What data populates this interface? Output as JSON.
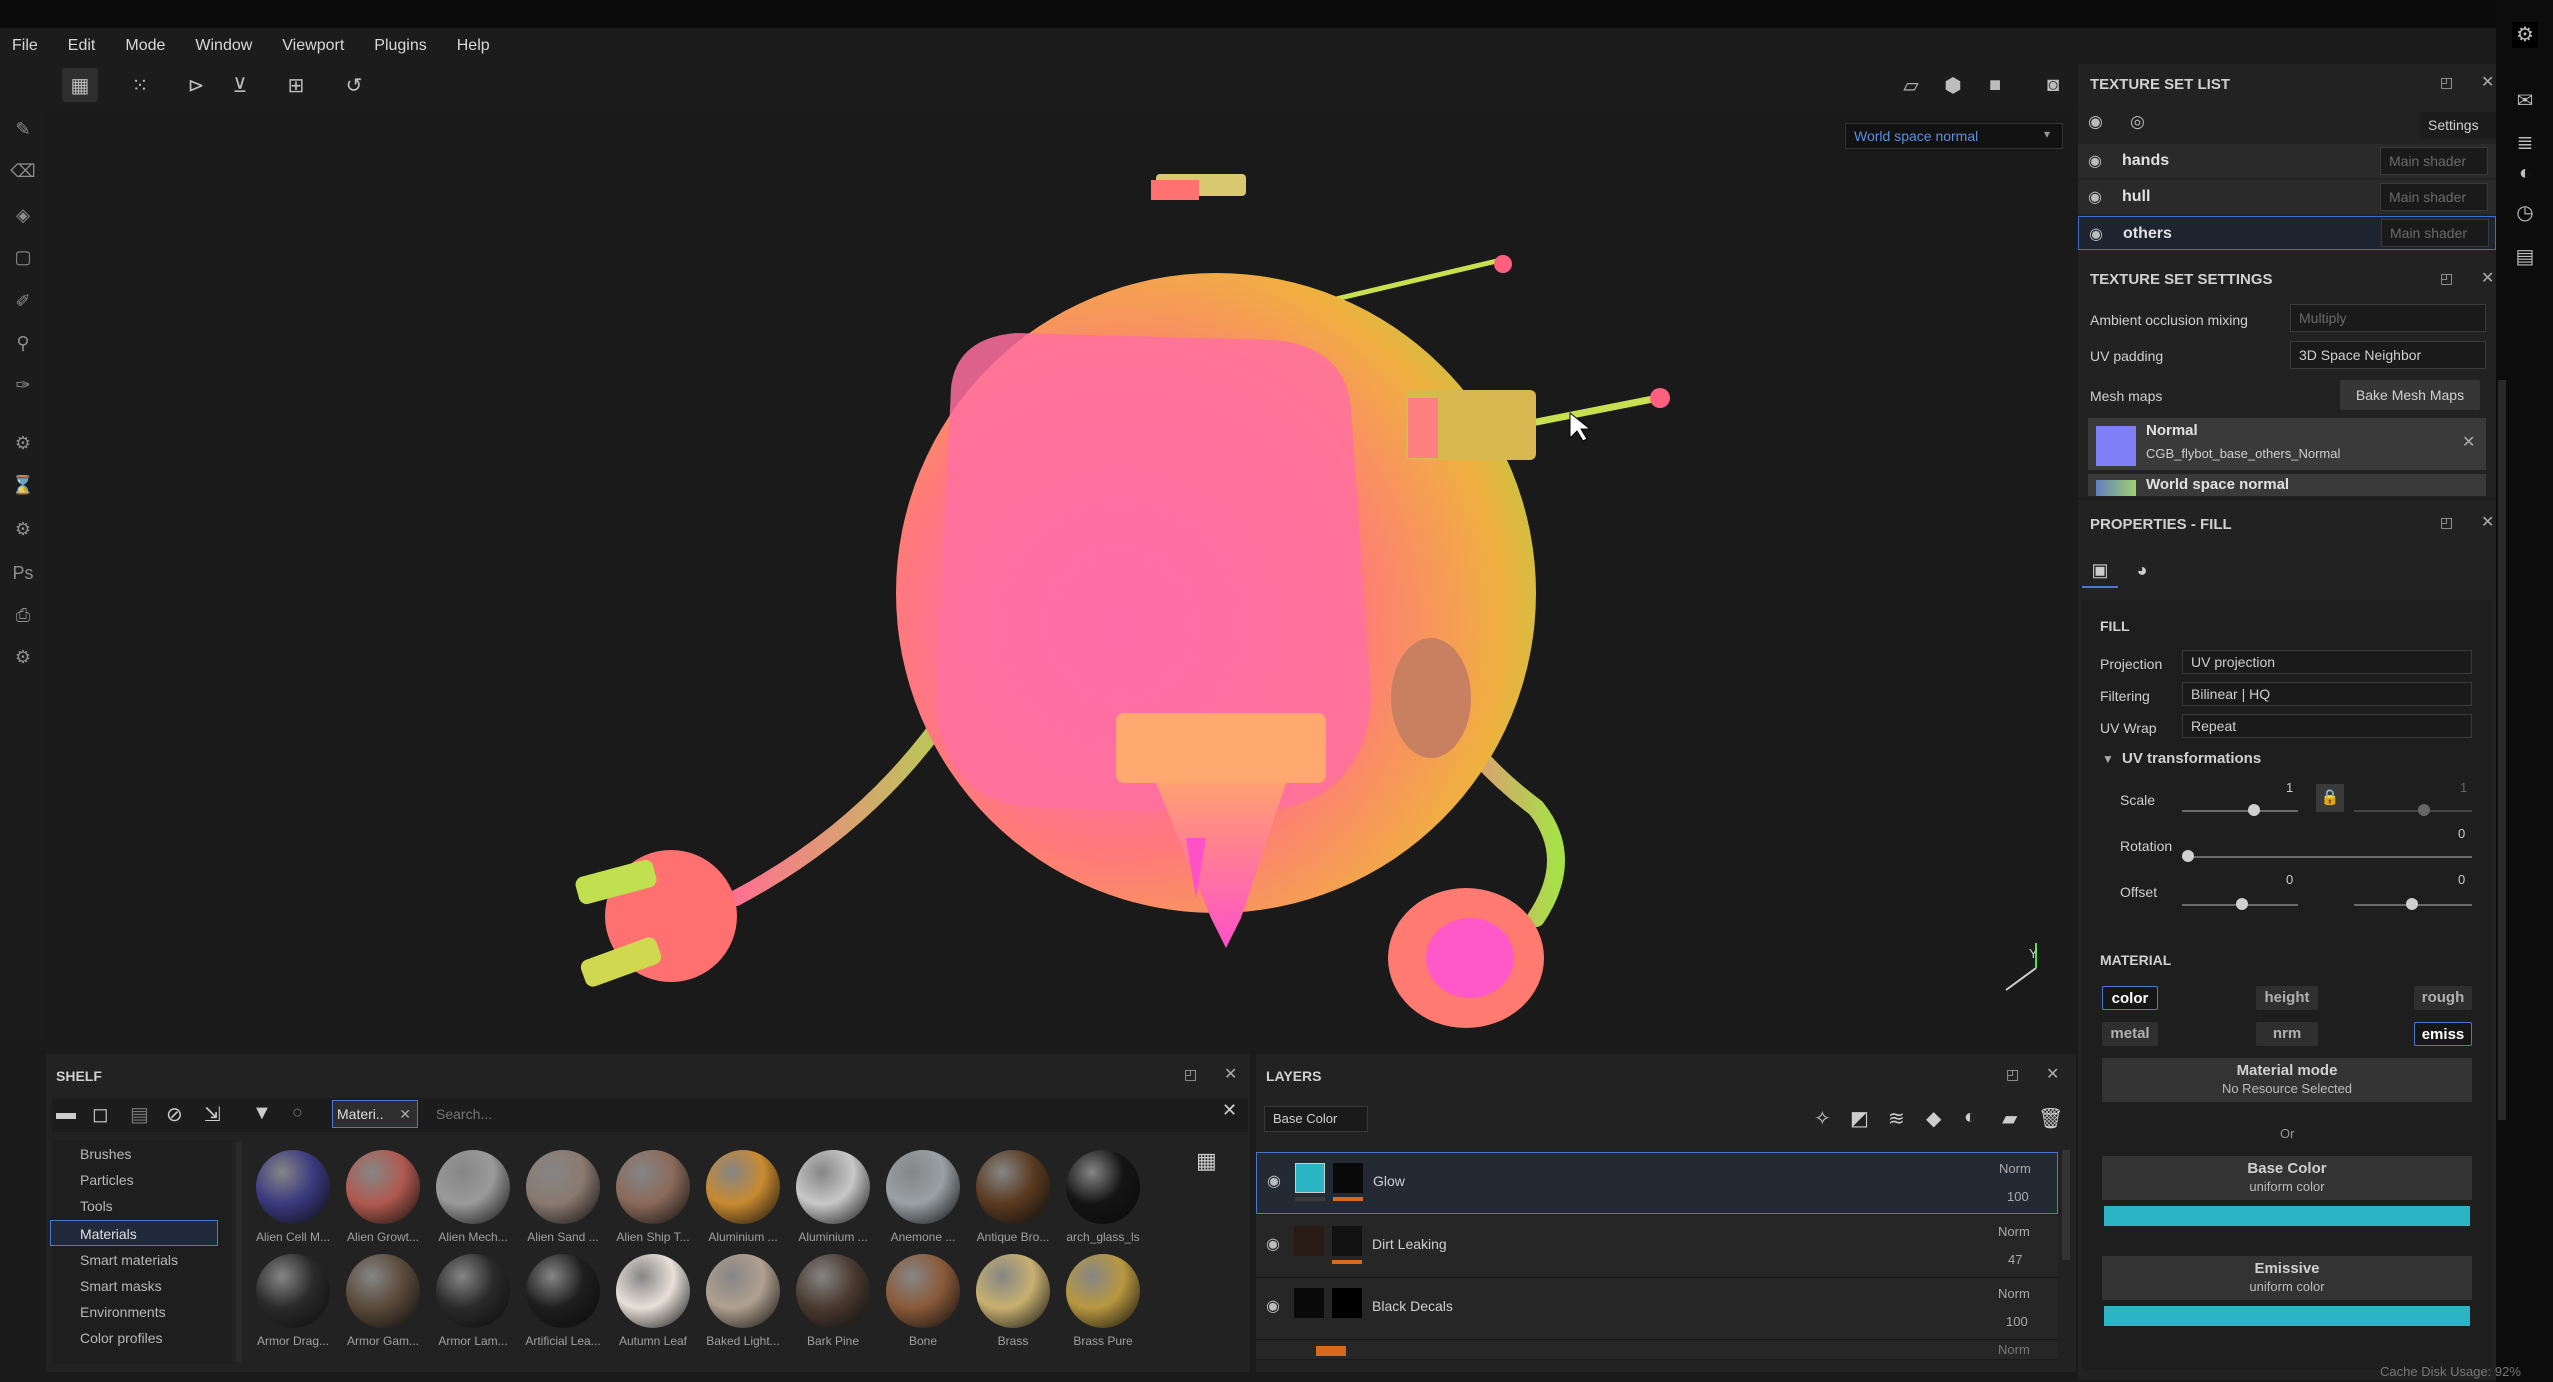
{
  "menu": [
    "File",
    "Edit",
    "Mode",
    "Window",
    "Viewport",
    "Plugins",
    "Help"
  ],
  "viewport": {
    "display_mode": "World space normal"
  },
  "texture_set_list": {
    "title": "TEXTURE SET LIST",
    "settings_label": "Settings",
    "sets": [
      {
        "name": "hands",
        "shader": "Main shader"
      },
      {
        "name": "hull",
        "shader": "Main shader"
      },
      {
        "name": "others",
        "shader": "Main shader"
      }
    ]
  },
  "texture_set_settings": {
    "title": "TEXTURE SET SETTINGS",
    "ao_label": "Ambient occlusion mixing",
    "ao_value": "Multiply",
    "uv_padding_label": "UV padding",
    "uv_padding_value": "3D Space Neighbor",
    "mesh_maps_label": "Mesh maps",
    "bake_button": "Bake Mesh Maps",
    "maps": [
      {
        "name": "Normal",
        "file": "CGB_flybot_base_others_Normal"
      },
      {
        "name": "World space normal"
      }
    ]
  },
  "properties": {
    "title": "PROPERTIES - FILL",
    "fill_heading": "FILL",
    "projection_label": "Projection",
    "projection_value": "UV projection",
    "filtering_label": "Filtering",
    "filtering_value": "Bilinear | HQ",
    "uvwrap_label": "UV Wrap",
    "uvwrap_value": "Repeat",
    "uv_transforms_label": "UV transformations",
    "scale_label": "Scale",
    "scale_value": "1",
    "scale_value2": "1",
    "rotation_label": "Rotation",
    "rotation_value": "0",
    "offset_label": "Offset",
    "offset_value": "0",
    "offset_value2": "0",
    "material_heading": "MATERIAL",
    "channels": [
      "color",
      "height",
      "rough",
      "metal",
      "nrm",
      "emiss"
    ],
    "material_mode_label": "Material mode",
    "material_mode_value": "No Resource Selected",
    "or_label": "Or",
    "base_color_label": "Base Color",
    "base_color_sub": "uniform color",
    "emissive_label": "Emissive",
    "emissive_sub": "uniform color",
    "base_color_hex": "#2bb5c4",
    "emissive_hex": "#2bb5c4"
  },
  "shelf": {
    "title": "SHELF",
    "filter_tag": "Materi..",
    "search_placeholder": "Search...",
    "categories": [
      "Brushes",
      "Particles",
      "Tools",
      "Materials",
      "Smart materials",
      "Smart masks",
      "Environments",
      "Color profiles"
    ],
    "selected_category": "Materials",
    "row1": [
      "Alien Cell M...",
      "Alien Growt...",
      "Alien Mech...",
      "Alien Sand ...",
      "Alien Ship T...",
      "Aluminium ...",
      "Aluminium ...",
      "Anemone ...",
      "Antique Bro...",
      "arch_glass_ls"
    ],
    "row2": [
      "Armor Drag...",
      "Armor Gam...",
      "Armor Lam...",
      "Artificial Lea...",
      "Autumn Leaf",
      "Baked Light...",
      "Bark Pine",
      "Bone",
      "Brass",
      "Brass Pure"
    ]
  },
  "layers": {
    "title": "LAYERS",
    "channel_select": "Base Color",
    "items": [
      {
        "name": "Glow",
        "blend": "Norm",
        "opacity": "100"
      },
      {
        "name": "Dirt Leaking",
        "blend": "Norm",
        "opacity": "47"
      },
      {
        "name": "Black Decals",
        "blend": "Norm",
        "opacity": "100"
      },
      {
        "name": "",
        "blend": "Norm",
        "opacity": ""
      }
    ]
  },
  "status": {
    "cache": "Cache Disk Usage:  92%"
  }
}
